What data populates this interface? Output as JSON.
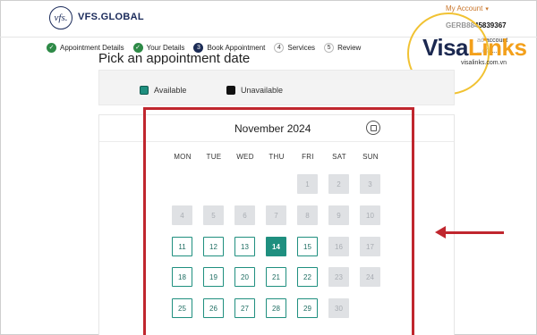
{
  "header": {
    "logo_mark": "vfs.",
    "logo_text": "VFS.GLOBAL",
    "account_label": "My Account",
    "reference": "GERB8845839367",
    "extra_line1": "ad account",
    "extra_line2": "...@.t..."
  },
  "watermark": {
    "brand_visa": "Visa",
    "brand_links": "Links",
    "site": "visalinks.com.vn"
  },
  "steps": [
    {
      "badge": "✓",
      "label": "Appointment Details",
      "state": "done"
    },
    {
      "badge": "✓",
      "label": "Your Details",
      "state": "done"
    },
    {
      "badge": "3",
      "label": "Book Appointment",
      "state": "current"
    },
    {
      "badge": "4",
      "label": "Services",
      "state": "todo"
    },
    {
      "badge": "5",
      "label": "Review",
      "state": "todo"
    }
  ],
  "page": {
    "title": "Pick an appointment date"
  },
  "legend": {
    "available": "Available",
    "unavailable": "Unavailable"
  },
  "calendar": {
    "month_label": "November 2024",
    "weekdays": [
      "MON",
      "TUE",
      "WED",
      "THU",
      "FRI",
      "SAT",
      "SUN"
    ],
    "selected_day": 14,
    "available_days": [
      11,
      12,
      13,
      14,
      15,
      18,
      19,
      20,
      21,
      22,
      25,
      26,
      27,
      28,
      29
    ],
    "unavailable_days": [
      1,
      2,
      3,
      4,
      5,
      6,
      7,
      8,
      9,
      10,
      16,
      17,
      23,
      24,
      30
    ],
    "weeks": [
      [
        "",
        "",
        "",
        "",
        "1",
        "2",
        "3"
      ],
      [
        "4",
        "5",
        "6",
        "7",
        "8",
        "9",
        "10"
      ],
      [
        "11",
        "12",
        "13",
        "14",
        "15",
        "16",
        "17"
      ],
      [
        "18",
        "19",
        "20",
        "21",
        "22",
        "23",
        "24"
      ],
      [
        "25",
        "26",
        "27",
        "28",
        "29",
        "30",
        ""
      ]
    ]
  },
  "colors": {
    "available": "#1f8f7f",
    "unavailable": "#dfe1e4",
    "highlight": "#c0262e",
    "brand_navy": "#1b2b55"
  }
}
